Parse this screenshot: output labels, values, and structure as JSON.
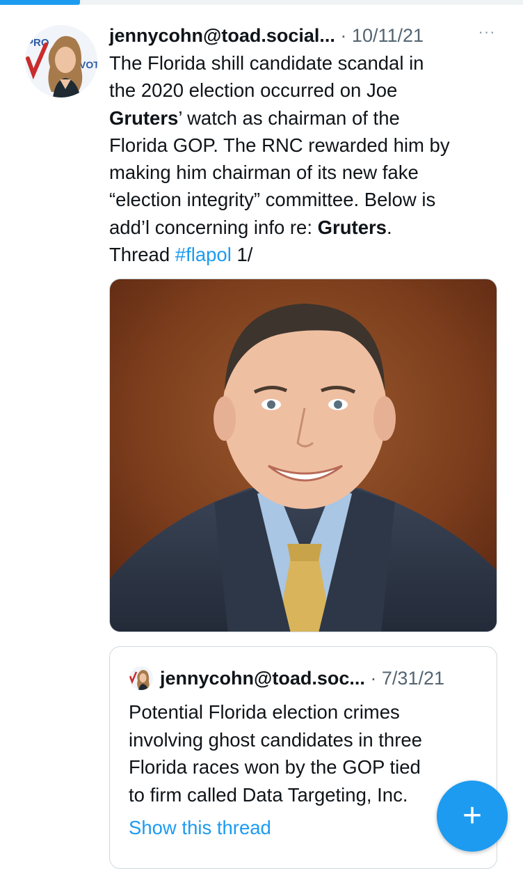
{
  "tweet": {
    "handle": "jennycohn@toad.social...",
    "separator": "·",
    "date": "10/11/21",
    "more_label": "···",
    "text_lines": [
      [
        {
          "t": "The Florida shill candidate scandal in"
        }
      ],
      [
        {
          "t": "the 2020 election occurred on Joe"
        }
      ],
      [
        {
          "t": "Gruters",
          "bold": true
        },
        {
          "t": "’ watch as chairman of the"
        }
      ],
      [
        {
          "t": "Florida GOP. The RNC rewarded him by"
        }
      ],
      [
        {
          "t": "making him chairman of its new fake"
        }
      ],
      [
        {
          "t": "“election integrity” committee. Below is"
        }
      ],
      [
        {
          "t": "add’l concerning info re: "
        },
        {
          "t": "Gruters",
          "bold": true
        },
        {
          "t": "."
        }
      ],
      [
        {
          "t": "Thread "
        },
        {
          "t": "#flapol",
          "link": true
        },
        {
          "t": " 1/"
        }
      ]
    ],
    "avatar_badge_text": "PRO",
    "avatar_badge_text_2": "VOTE"
  },
  "quote": {
    "handle": "jennycohn@toad.soc...",
    "separator": "·",
    "date": "7/31/21",
    "text_lines": [
      "Potential Florida election crimes",
      "involving ghost candidates in three",
      "Florida races won by the GOP tied",
      "to firm called Data Targeting, Inc."
    ],
    "show_thread_label": "Show this thread"
  },
  "fab": {
    "label": "+"
  },
  "colors": {
    "accent": "#1d9bf0",
    "text": "#0f1419",
    "secondary": "#536471",
    "border": "#cfd9de"
  },
  "icons": {
    "more": "more-horizontal-icon",
    "compose": "plus-icon"
  }
}
